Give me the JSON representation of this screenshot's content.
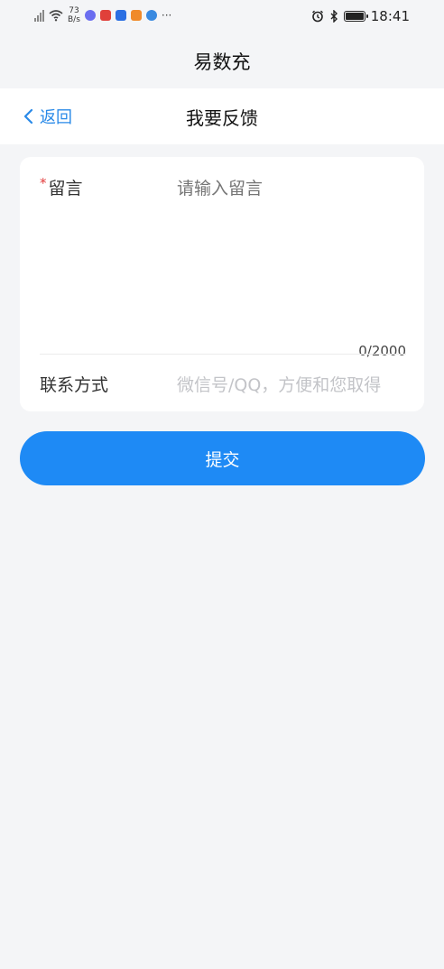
{
  "status_bar": {
    "net_speed_value": "73",
    "net_speed_unit": "B/s",
    "more": "···",
    "time": "18:41",
    "battery_level": 1.0,
    "app_icon_colors": [
      "#6b6ef0",
      "#e0403a",
      "#2b6fe3",
      "#f08a2a",
      "#3a8ae0"
    ]
  },
  "app": {
    "title": "易数充"
  },
  "nav": {
    "back_label": "返回",
    "title": "我要反馈"
  },
  "form": {
    "message": {
      "required_mark": "*",
      "label": "留言",
      "placeholder": "请输入留言",
      "counter": "0/2000"
    },
    "contact": {
      "label": "联系方式",
      "placeholder": "微信号/QQ，方便和您取得"
    }
  },
  "submit_label": "提交",
  "colors": {
    "accent": "#1e8af5",
    "back_link": "#2a8ae8",
    "required": "#e23b3b",
    "background": "#f4f5f7"
  }
}
